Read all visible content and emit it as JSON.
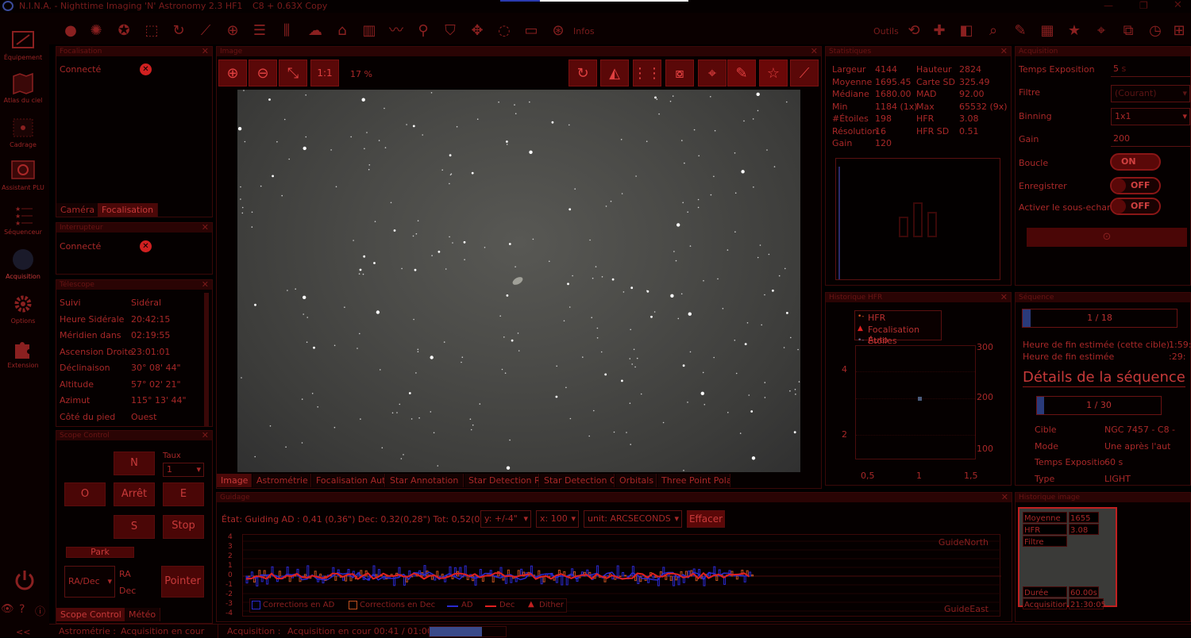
{
  "window": {
    "title": "N.I.N.A. - Nighttime Imaging 'N' Astronomy 2.3 HF1",
    "profile": "C8 + 0.63X  Copy"
  },
  "sidebar": {
    "items": [
      {
        "label": "Équipement",
        "icon": "camera-icon"
      },
      {
        "label": "Atlas du ciel",
        "icon": "map-icon"
      },
      {
        "label": "Cadrage",
        "icon": "framing-icon"
      },
      {
        "label": "Assistant PLU",
        "icon": "flat-wizard-icon"
      },
      {
        "label": "Séquenceur",
        "icon": "sequencer-icon"
      },
      {
        "label": "Acquisition",
        "icon": "imaging-icon"
      },
      {
        "label": "Options",
        "icon": "gear-icon"
      },
      {
        "label": "Extension",
        "icon": "puzzle-icon"
      }
    ]
  },
  "toolbar": {
    "info_label": "Infos",
    "tools_label": "Outils"
  },
  "focuser_panel": {
    "title": "Focalisation",
    "status": "Connecté",
    "tabs": [
      "Caméra",
      "Focalisation"
    ]
  },
  "switch_panel": {
    "title": "Interrupteur",
    "status": "Connecté"
  },
  "telescope_panel": {
    "title": "Télescope",
    "rows": [
      {
        "label": "Suivi",
        "value": "Sidéral"
      },
      {
        "label": "Heure Sidérale",
        "value": "20:42:15"
      },
      {
        "label": "Méridien dans",
        "value": "02:19:55"
      },
      {
        "label": "Ascension Droite",
        "value": "23:01:01"
      },
      {
        "label": "Déclinaison",
        "value": "30° 08' 44\""
      },
      {
        "label": "Altitude",
        "value": "57° 02' 21\""
      },
      {
        "label": "Azimut",
        "value": "115° 13' 44\""
      },
      {
        "label": "Côté du pied",
        "value": "Ouest"
      }
    ]
  },
  "scope_control": {
    "title": "Scope Control",
    "north": "N",
    "west": "O",
    "stop": "Arrêt",
    "east": "E",
    "south": "S",
    "stop2": "Stop",
    "rate_label": "Taux",
    "rate_value": "1",
    "park": "Park",
    "coord_mode": "RA/Dec",
    "ra_label": "RA",
    "dec_label": "Dec",
    "slew_button": "Pointer",
    "tabs": [
      "Scope Control",
      "Météo"
    ]
  },
  "image_panel": {
    "title": "Image",
    "zoom_ratio": "1:1",
    "zoom_percent": "17 %",
    "tabs": [
      "Image",
      "Astrométrie",
      "Focalisation Aut",
      "Star Annotation",
      "Star Detection R",
      "Star Detection C",
      "Orbitals",
      "Three Point Pola"
    ]
  },
  "statistics": {
    "title": "Statistiques",
    "rows": [
      {
        "l1": "Largeur",
        "v1": "4144",
        "l2": "Hauteur",
        "v2": "2824"
      },
      {
        "l1": "Moyenne",
        "v1": "1695.45",
        "l2": "Carte SD",
        "v2": "325.49"
      },
      {
        "l1": "Médiane",
        "v1": "1680.00",
        "l2": "MAD",
        "v2": "92.00"
      },
      {
        "l1": "Min",
        "v1": "1184 (1x)",
        "l2": "Max",
        "v2": "65532 (9x)"
      },
      {
        "l1": "#Étoiles",
        "v1": "198",
        "l2": "HFR",
        "v2": "3.08"
      },
      {
        "l1": "Résolution",
        "v1": "16",
        "l2": "HFR SD",
        "v2": "0.51"
      },
      {
        "l1": "Gain",
        "v1": "120",
        "l2": "",
        "v2": ""
      }
    ]
  },
  "hfr_history": {
    "title": "Historique HFR",
    "legend": [
      "HFR",
      "Focalisation Auto",
      "Étoiles"
    ],
    "left_ticks": [
      "4",
      "2"
    ],
    "right_ticks": [
      "300",
      "200",
      "100"
    ],
    "x_ticks": [
      "0,5",
      "1",
      "1,5"
    ]
  },
  "acquisition": {
    "title": "Acquisition",
    "exposure_label": "Temps Exposition",
    "exposure_value": "5",
    "exposure_unit": "s",
    "filter_label": "Filtre",
    "filter_value": "(Courant)",
    "binning_label": "Binning",
    "binning_value": "1x1",
    "gain_label": "Gain",
    "gain_value": "200",
    "loop_label": "Boucle",
    "loop_value": "ON",
    "save_label": "Enregistrer",
    "save_value": "OFF",
    "subsample_label": "Activer le sous-echan",
    "subsample_value": "OFF"
  },
  "sequence": {
    "title": "Séquence",
    "progress1": "1 / 18",
    "end_target_label": "Heure de fin estimée (cette cible)",
    "end_target_value": "1:59:",
    "end_label": "Heure de fin estimée",
    "end_value": ":29:",
    "details_title": "Détails de la séquence",
    "progress2": "1 / 30",
    "progress_fraction": 0.06,
    "rows": [
      {
        "label": "Cible",
        "value": "NGC 7457 - C8 -"
      },
      {
        "label": "Mode",
        "value": "Une après l'aut"
      },
      {
        "label": "Temps Expositio",
        "value": "60 s"
      },
      {
        "label": "Type",
        "value": "LIGHT"
      }
    ]
  },
  "guiding": {
    "title": "Guidage",
    "status": "État: Guiding  AD : 0,41 (0,36\")  Dec: 0,32(0,28\")  Tot: 0,52(0,46\")",
    "y_scale": "y: +/-4\"",
    "x_scale": "x: 100",
    "unit": "unit: ARCSECONDS",
    "clear": "Effacer",
    "north_label": "GuideNorth",
    "east_label": "GuideEast",
    "y_ticks": [
      "4",
      "3",
      "2",
      "1",
      "0",
      "-1",
      "-2",
      "-3",
      "-4"
    ],
    "legend": [
      "Corrections en AD",
      "Corrections en Dec",
      "AD",
      "Dec",
      "Dither"
    ]
  },
  "image_history": {
    "title": "Historique image",
    "mean_label": "Moyenne",
    "mean_value": "1655",
    "hfr_label": "HFR",
    "hfr_value": "3.08",
    "filter_label": "Filtre",
    "duration_label": "Durée",
    "duration_value": "60.00s",
    "acq_label": "Acquisition",
    "acq_value": "21:30:05"
  },
  "statusbar": {
    "astrometry_label": "Astrométrie :",
    "astrometry_value": "Acquisition en cour",
    "acquisition_label": "Acquisition :",
    "acquisition_value": "Acquisition en cour 00:41 / 01:00"
  },
  "colors": {
    "accent": "#c83a3a",
    "panel_bg": "#050000",
    "title_bg": "#2a0404",
    "ad_color": "#2a2ad0",
    "dec_color": "#e02020"
  }
}
